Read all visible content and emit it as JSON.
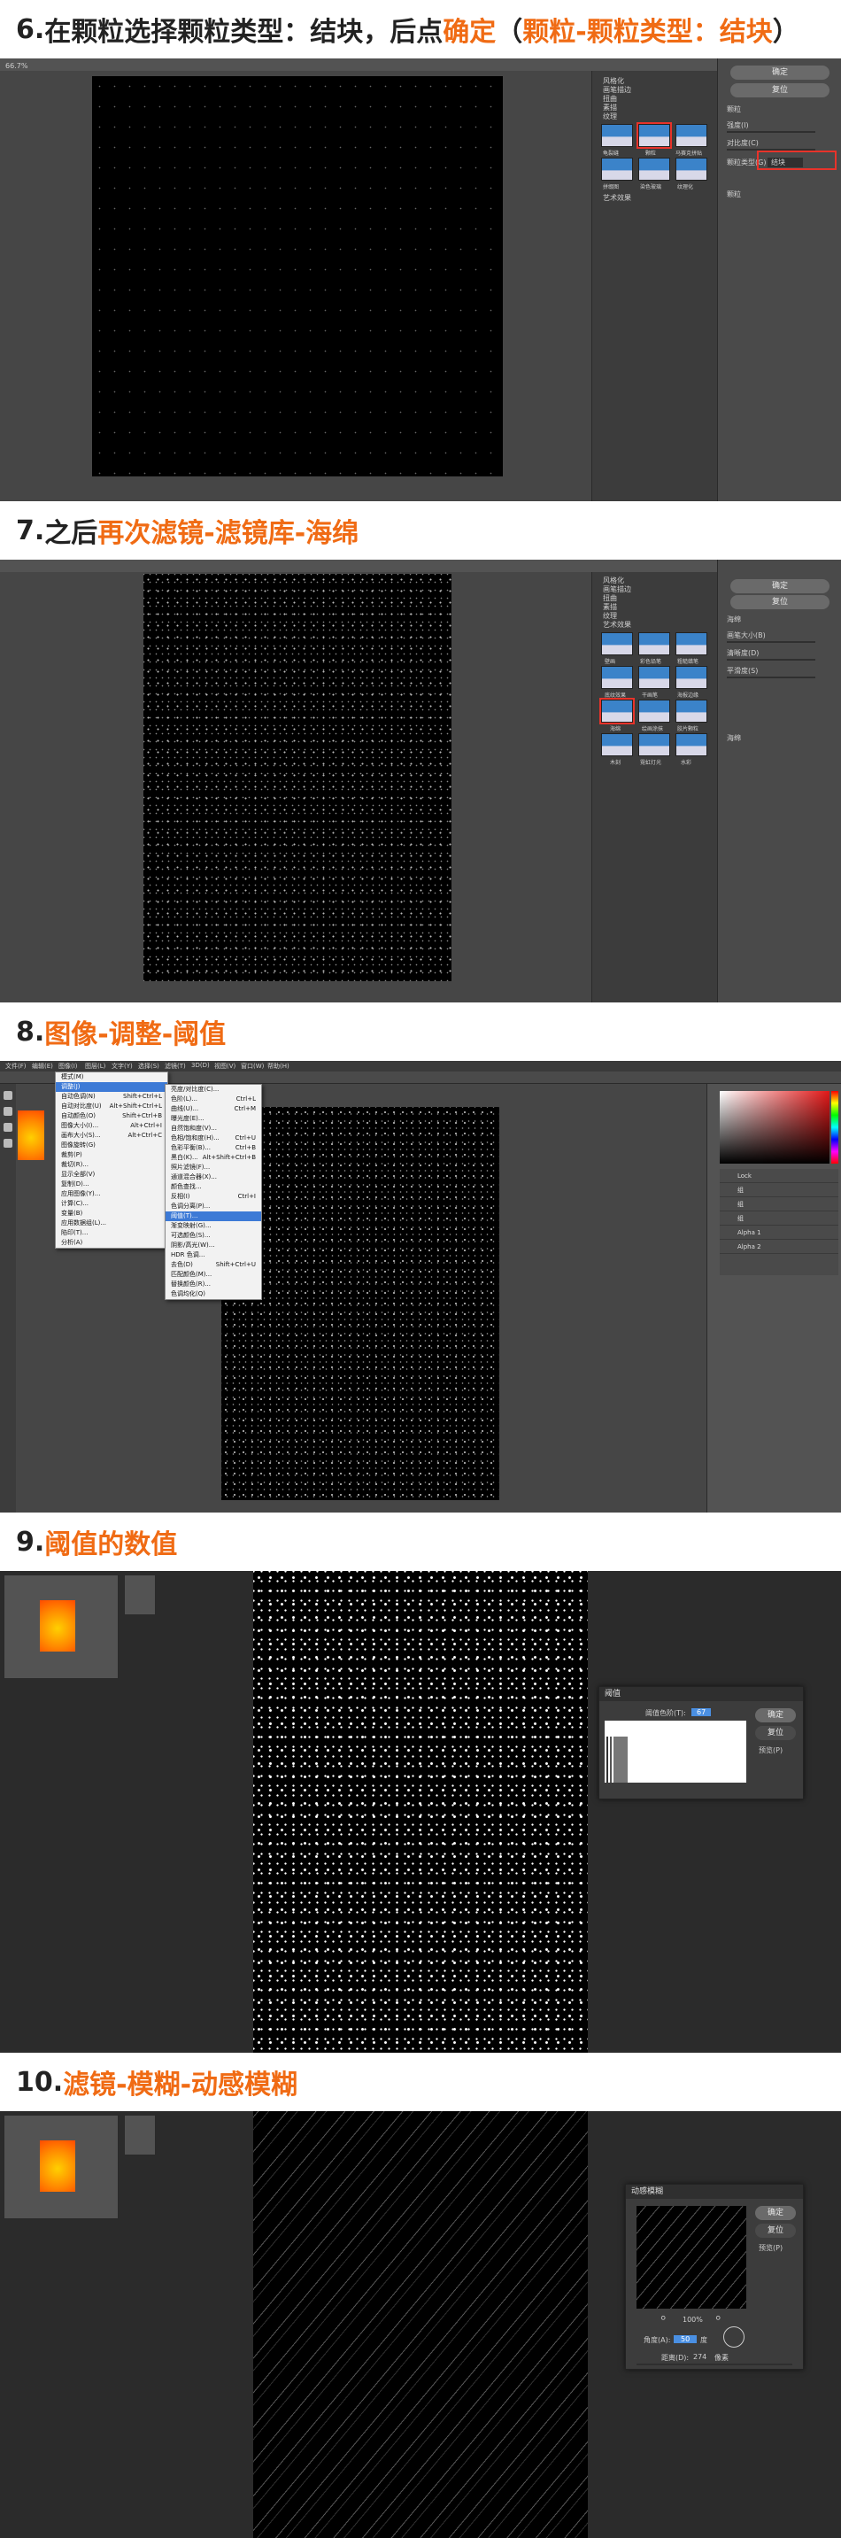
{
  "steps": [
    {
      "number": "6.",
      "lead": "在颗粒选择颗粒类型：结块，后点",
      "highlight": "确定",
      "tail": "（",
      "highlight2": "颗粒-颗粒类型：结块",
      "tail2": "）"
    },
    {
      "number": "7.",
      "lead": "之后",
      "highlight": "再次滤镜-滤镜库-海绵"
    },
    {
      "number": "8.",
      "highlight": "图像-调整-阈值"
    },
    {
      "number": "9.",
      "highlight": "阈值的数值"
    },
    {
      "number": "10.",
      "highlight": "滤镜-模糊-动感模糊"
    }
  ],
  "filter_gallery": {
    "ok_label": "确定",
    "reset_label": "复位",
    "zoom_label": "66.7%",
    "grain_label": "颗粒",
    "intensity_label": "强度(I)",
    "contrast_label": "对比度(C)",
    "grain_type_label": "颗粒类型(G)",
    "grain_type_value": "结块",
    "sponge_label": "海绵",
    "brush_size_label": "画笔大小(B)",
    "definition_label": "清晰度(D)",
    "smoothness_label": "平滑度(S)",
    "folders": [
      "风格化",
      "画笔描边",
      "扭曲",
      "素描",
      "纹理",
      "艺术效果"
    ],
    "texture_thumbs": [
      "龟裂缝",
      "颗粒",
      "马赛克拼贴",
      "拼缀图",
      "染色玻璃",
      "纹理化"
    ],
    "art_thumbs": [
      "壁画",
      "彩色铅笔",
      "粗糙蜡笔",
      "底纹效果",
      "干画笔",
      "海报边缘",
      "海绵",
      "绘画涂抹",
      "胶片颗粒",
      "木刻",
      "霓虹灯光",
      "水彩"
    ]
  },
  "menu": {
    "top_items": [
      "文件(F)",
      "编辑(E)",
      "图像(I)",
      "图层(L)",
      "文字(Y)",
      "选择(S)",
      "滤镜(T)",
      "3D(D)",
      "视图(V)",
      "窗口(W)",
      "帮助(H)"
    ],
    "image_menu": [
      {
        "label": "模式(M)",
        "shortcut": ""
      },
      {
        "label": "调整(J)",
        "shortcut": "",
        "active": true
      },
      {
        "label": "自动色调(N)",
        "shortcut": "Shift+Ctrl+L"
      },
      {
        "label": "自动对比度(U)",
        "shortcut": "Alt+Shift+Ctrl+L"
      },
      {
        "label": "自动颜色(O)",
        "shortcut": "Shift+Ctrl+B"
      },
      {
        "label": "图像大小(I)...",
        "shortcut": "Alt+Ctrl+I"
      },
      {
        "label": "画布大小(S)...",
        "shortcut": "Alt+Ctrl+C"
      },
      {
        "label": "图像旋转(G)",
        "shortcut": ""
      },
      {
        "label": "裁剪(P)",
        "shortcut": ""
      },
      {
        "label": "裁切(R)...",
        "shortcut": ""
      },
      {
        "label": "显示全部(V)",
        "shortcut": ""
      },
      {
        "label": "复制(D)...",
        "shortcut": ""
      },
      {
        "label": "应用图像(Y)...",
        "shortcut": ""
      },
      {
        "label": "计算(C)...",
        "shortcut": ""
      },
      {
        "label": "变量(B)",
        "shortcut": ""
      },
      {
        "label": "应用数据组(L)...",
        "shortcut": ""
      },
      {
        "label": "陷印(T)...",
        "shortcut": ""
      },
      {
        "label": "分析(A)",
        "shortcut": ""
      }
    ],
    "adjust_menu": [
      {
        "label": "亮度/对比度(C)...",
        "shortcut": ""
      },
      {
        "label": "色阶(L)...",
        "shortcut": "Ctrl+L"
      },
      {
        "label": "曲线(U)...",
        "shortcut": "Ctrl+M"
      },
      {
        "label": "曝光度(E)...",
        "shortcut": ""
      },
      {
        "label": "自然饱和度(V)...",
        "shortcut": ""
      },
      {
        "label": "色相/饱和度(H)...",
        "shortcut": "Ctrl+U"
      },
      {
        "label": "色彩平衡(B)...",
        "shortcut": "Ctrl+B"
      },
      {
        "label": "黑白(K)...",
        "shortcut": "Alt+Shift+Ctrl+B"
      },
      {
        "label": "照片滤镜(F)...",
        "shortcut": ""
      },
      {
        "label": "通道混合器(X)...",
        "shortcut": ""
      },
      {
        "label": "颜色查找...",
        "shortcut": ""
      },
      {
        "label": "反相(I)",
        "shortcut": "Ctrl+I"
      },
      {
        "label": "色调分离(P)...",
        "shortcut": ""
      },
      {
        "label": "阈值(T)...",
        "shortcut": "",
        "active": true
      },
      {
        "label": "渐变映射(G)...",
        "shortcut": ""
      },
      {
        "label": "可选颜色(S)...",
        "shortcut": ""
      },
      {
        "label": "阴影/高光(W)...",
        "shortcut": ""
      },
      {
        "label": "HDR 色调...",
        "shortcut": ""
      },
      {
        "label": "去色(D)",
        "shortcut": "Shift+Ctrl+U"
      },
      {
        "label": "匹配颜色(M)...",
        "shortcut": ""
      },
      {
        "label": "替换颜色(R)...",
        "shortcut": ""
      },
      {
        "label": "色调均化(Q)",
        "shortcut": ""
      }
    ],
    "layers": [
      "Lock",
      "组",
      "组",
      "组",
      "Alpha 1",
      "Alpha 2"
    ]
  },
  "threshold": {
    "title": "阈值",
    "level_label": "阈值色阶(T):",
    "level_value": "67",
    "ok_label": "确定",
    "reset_label": "复位",
    "preview_label": "预览(P)"
  },
  "motion_blur": {
    "title": "动感模糊",
    "ok_label": "确定",
    "reset_label": "复位",
    "preview_label": "预览(P)",
    "zoom": "100%",
    "angle_label": "角度(A):",
    "angle_value": "50",
    "angle_unit": "度",
    "distance_label": "距离(D):",
    "distance_value": "274",
    "distance_unit": "像素"
  },
  "colors": {
    "accent": "#f06b14",
    "highlight_box": "#e8332a",
    "ps_bg": "#535353"
  }
}
